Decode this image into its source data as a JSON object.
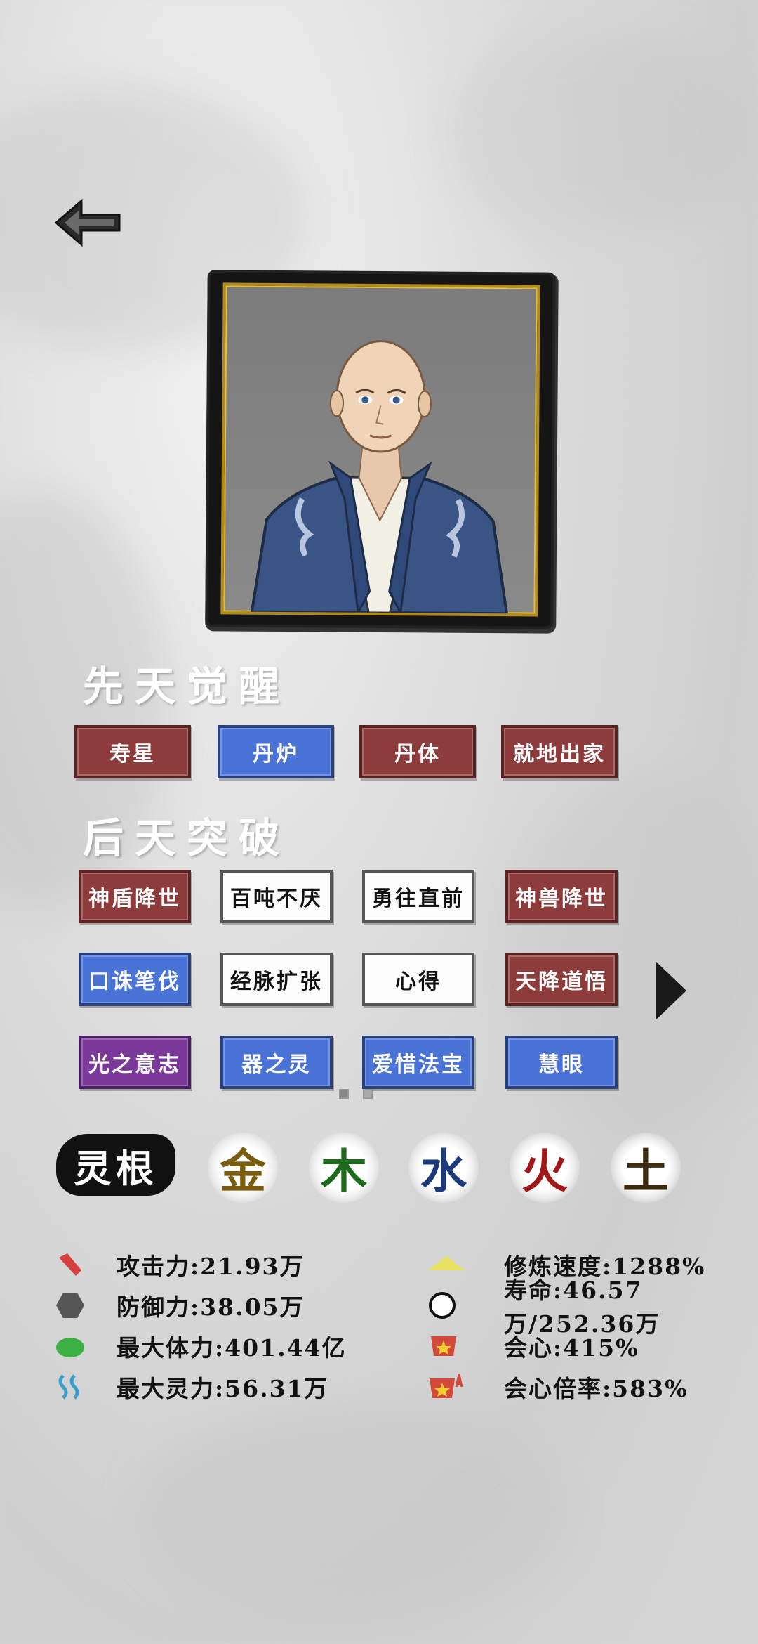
{
  "colors": {
    "talent_red": "#8d3b3b",
    "talent_blue": "#4a73d8",
    "talent_white": "#fdfdfd",
    "talent_purple": "#7b3a99",
    "metal": "#7a5c0e",
    "wood": "#1d6a1a",
    "water": "#1c3a7a",
    "fire": "#a01818",
    "earth": "#3a2a10"
  },
  "sections": {
    "innate_title": "先天觉醒",
    "acquired_title": "后天突破"
  },
  "innate": [
    {
      "label": "寿星",
      "style": "red"
    },
    {
      "label": "丹炉",
      "style": "blue"
    },
    {
      "label": "丹体",
      "style": "red"
    },
    {
      "label": "就地出家",
      "style": "red"
    }
  ],
  "acquired": [
    {
      "label": "神盾降世",
      "style": "red"
    },
    {
      "label": "百吨不厌",
      "style": "white"
    },
    {
      "label": "勇往直前",
      "style": "white"
    },
    {
      "label": "神兽降世",
      "style": "red"
    },
    {
      "label": "口诛笔伐",
      "style": "blue"
    },
    {
      "label": "经脉扩张",
      "style": "white"
    },
    {
      "label": "心得",
      "style": "white"
    },
    {
      "label": "天降道悟",
      "style": "red"
    },
    {
      "label": "光之意志",
      "style": "purple"
    },
    {
      "label": "器之灵",
      "style": "blue"
    },
    {
      "label": "爱惜法宝",
      "style": "blue"
    },
    {
      "label": "慧眼",
      "style": "blue"
    }
  ],
  "linggen": {
    "label": "灵根",
    "elements": [
      "金",
      "木",
      "水",
      "火",
      "土"
    ]
  },
  "stats_left": [
    {
      "label": "攻击力:21.93万",
      "icon": "attack-icon"
    },
    {
      "label": "防御力:38.05万",
      "icon": "defense-icon"
    },
    {
      "label": "最大体力:401.44亿",
      "icon": "health-icon"
    },
    {
      "label": "最大灵力:56.31万",
      "icon": "spirit-icon"
    }
  ],
  "stats_right": [
    {
      "label": "修炼速度:1288%",
      "icon": "cultivation-speed-icon"
    },
    {
      "label": "寿命:46.57万/252.36万",
      "icon": "lifespan-icon"
    },
    {
      "label": "会心:415%",
      "icon": "critical-icon"
    },
    {
      "label": "会心倍率:583%",
      "icon": "critical-multiplier-icon"
    }
  ]
}
